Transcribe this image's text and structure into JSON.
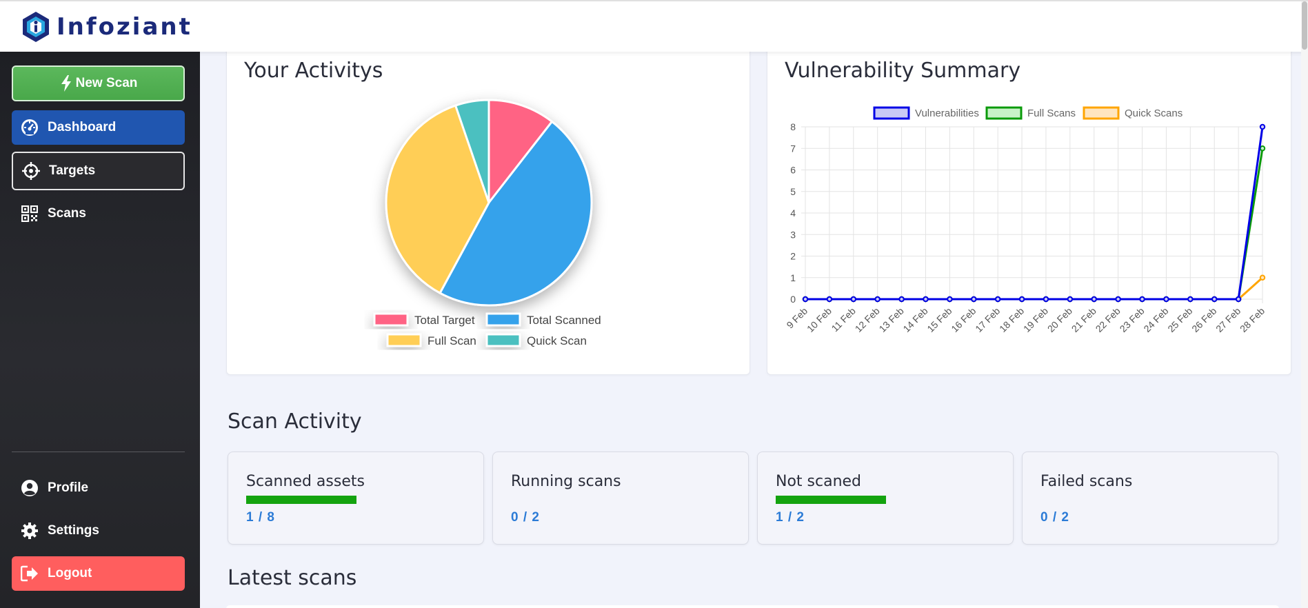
{
  "brand": {
    "name": "Infoziant"
  },
  "sidebar": {
    "new_scan": "New Scan",
    "items": [
      {
        "label": "Dashboard",
        "icon": "dashboard-gauge-icon"
      },
      {
        "label": "Targets",
        "icon": "crosshair-icon"
      },
      {
        "label": "Scans",
        "icon": "qr-grid-icon"
      }
    ],
    "bottom": [
      {
        "label": "Profile",
        "icon": "user-circle-icon"
      },
      {
        "label": "Settings",
        "icon": "gear-icon"
      },
      {
        "label": "Logout",
        "icon": "logout-icon"
      }
    ]
  },
  "activity": {
    "title": "Your Activitys",
    "chart_data": {
      "type": "pie",
      "labels": [
        "Total Target",
        "Total Scanned",
        "Full Scan",
        "Quick Scan"
      ],
      "values": [
        1,
        4.5,
        3.5,
        0.5
      ],
      "colors": [
        "#ff6384",
        "#36a2eb",
        "#ffce56",
        "#4bc0c0"
      ]
    }
  },
  "vulnerability": {
    "title": "Vulnerability Summary",
    "chart_data": {
      "type": "line",
      "x": [
        "9 Feb",
        "10 Feb",
        "11 Feb",
        "12 Feb",
        "13 Feb",
        "14 Feb",
        "15 Feb",
        "16 Feb",
        "17 Feb",
        "18 Feb",
        "19 Feb",
        "20 Feb",
        "21 Feb",
        "22 Feb",
        "23 Feb",
        "24 Feb",
        "25 Feb",
        "26 Feb",
        "27 Feb",
        "28 Feb"
      ],
      "ylim": [
        0,
        8
      ],
      "yticks": [
        0,
        1,
        2,
        3,
        4,
        5,
        6,
        7,
        8
      ],
      "grid": true,
      "legend": "top-center",
      "series": [
        {
          "name": "Vulnerabilities",
          "color": "#0000e6",
          "fill": "#c9c9f5",
          "values": [
            0,
            0,
            0,
            0,
            0,
            0,
            0,
            0,
            0,
            0,
            0,
            0,
            0,
            0,
            0,
            0,
            0,
            0,
            0,
            8
          ]
        },
        {
          "name": "Full Scans",
          "color": "#0a9a0a",
          "fill": "#c8f2c8",
          "values": [
            0,
            0,
            0,
            0,
            0,
            0,
            0,
            0,
            0,
            0,
            0,
            0,
            0,
            0,
            0,
            0,
            0,
            0,
            0,
            7
          ]
        },
        {
          "name": "Quick Scans",
          "color": "#ffa500",
          "fill": "#ffe5c0",
          "values": [
            0,
            0,
            0,
            0,
            0,
            0,
            0,
            0,
            0,
            0,
            0,
            0,
            0,
            0,
            0,
            0,
            0,
            0,
            0,
            1
          ]
        }
      ]
    }
  },
  "scan_activity": {
    "title": "Scan Activity",
    "cards": [
      {
        "label": "Scanned assets",
        "value": "1 / 8",
        "progress": 1.0
      },
      {
        "label": "Running scans",
        "value": "0 / 2",
        "progress": 0
      },
      {
        "label": "Not scaned",
        "value": "1 / 2",
        "progress": 1.0
      },
      {
        "label": "Failed scans",
        "value": "0 / 2",
        "progress": 0
      }
    ]
  },
  "latest_scans": {
    "title": "Latest scans"
  }
}
